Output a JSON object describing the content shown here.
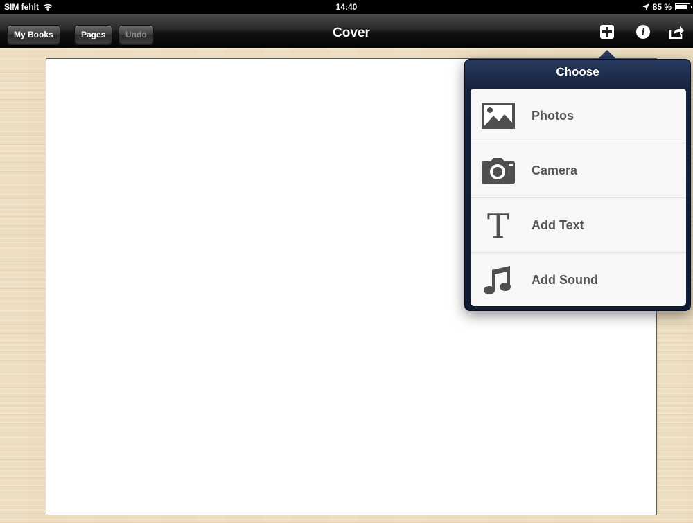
{
  "status_bar": {
    "carrier": "SIM fehlt",
    "time": "14:40",
    "battery": "85 %",
    "battery_level": 0.85
  },
  "toolbar": {
    "my_books_label": "My Books",
    "pages_label": "Pages",
    "undo_label": "Undo",
    "title": "Cover",
    "icons": [
      "plus-icon",
      "info-icon",
      "share-icon"
    ]
  },
  "popover": {
    "title": "Choose",
    "items": [
      {
        "label": "Photos",
        "icon": "photo-icon"
      },
      {
        "label": "Camera",
        "icon": "camera-icon"
      },
      {
        "label": "Add Text",
        "icon": "text-icon"
      },
      {
        "label": "Add Sound",
        "icon": "music-note-icon"
      }
    ]
  },
  "colors": {
    "toolbar": "#1a1a1a",
    "popover": "#16223d",
    "menu_text": "#555555",
    "background": "#ecdcbd"
  }
}
